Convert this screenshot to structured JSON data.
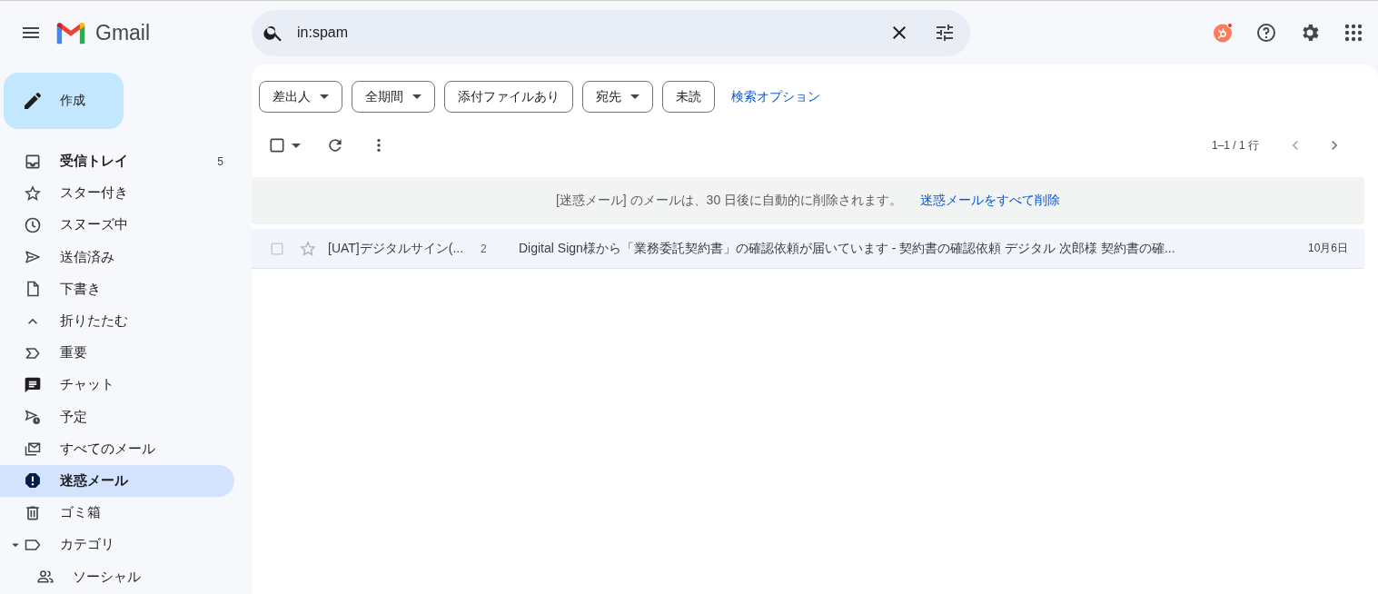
{
  "header": {
    "logo_text": "Gmail",
    "search": {
      "value": "in:spam"
    }
  },
  "compose": {
    "label": "作成"
  },
  "sidebar": {
    "items": [
      {
        "label": "受信トレイ",
        "count": "5",
        "selected": false,
        "bold": true
      },
      {
        "label": "スター付き",
        "selected": false,
        "bold": false
      },
      {
        "label": "スヌーズ中",
        "selected": false,
        "bold": false
      },
      {
        "label": "送信済み",
        "selected": false,
        "bold": false
      },
      {
        "label": "下書き",
        "selected": false,
        "bold": false
      },
      {
        "label": "折りたたむ",
        "selected": false,
        "bold": false
      },
      {
        "label": "重要",
        "selected": false,
        "bold": false
      },
      {
        "label": "チャット",
        "selected": false,
        "bold": false
      },
      {
        "label": "予定",
        "selected": false,
        "bold": false
      },
      {
        "label": "すべてのメール",
        "selected": false,
        "bold": false
      },
      {
        "label": "迷惑メール",
        "selected": true,
        "bold": true
      },
      {
        "label": "ゴミ箱",
        "selected": false,
        "bold": false
      },
      {
        "label": "カテゴリ",
        "selected": false,
        "bold": false,
        "expanded": true,
        "children": [
          {
            "label": "ソーシャル",
            "selected": false,
            "bold": false
          }
        ]
      }
    ]
  },
  "filters": [
    {
      "label": "差出人",
      "kind": "dropdown"
    },
    {
      "label": "全期間",
      "kind": "dropdown"
    },
    {
      "label": "添付ファイルあり",
      "kind": "toggle"
    },
    {
      "label": "宛先",
      "kind": "dropdown"
    },
    {
      "label": "未読",
      "kind": "toggle"
    }
  ],
  "search_options_link": "検索オプション",
  "toolbar": {
    "select_all_checked": false,
    "pagination": "1–1 / 1 行"
  },
  "banner": {
    "text": "[迷惑メール] のメールは、30 日後に自動的に削除されます。",
    "action": "迷惑メールをすべて削除"
  },
  "messages": [
    {
      "sender": "[UAT]デジタルサイン(...",
      "thread_count": "2",
      "subject": "Digital Sign様から「業務委託契約書」の確認依頼が届いています - 契約書の確認依頼 デジタル 次郎様 契約書の確...",
      "date": "10月6日",
      "checked": false,
      "starred": false,
      "unread": false
    }
  ]
}
